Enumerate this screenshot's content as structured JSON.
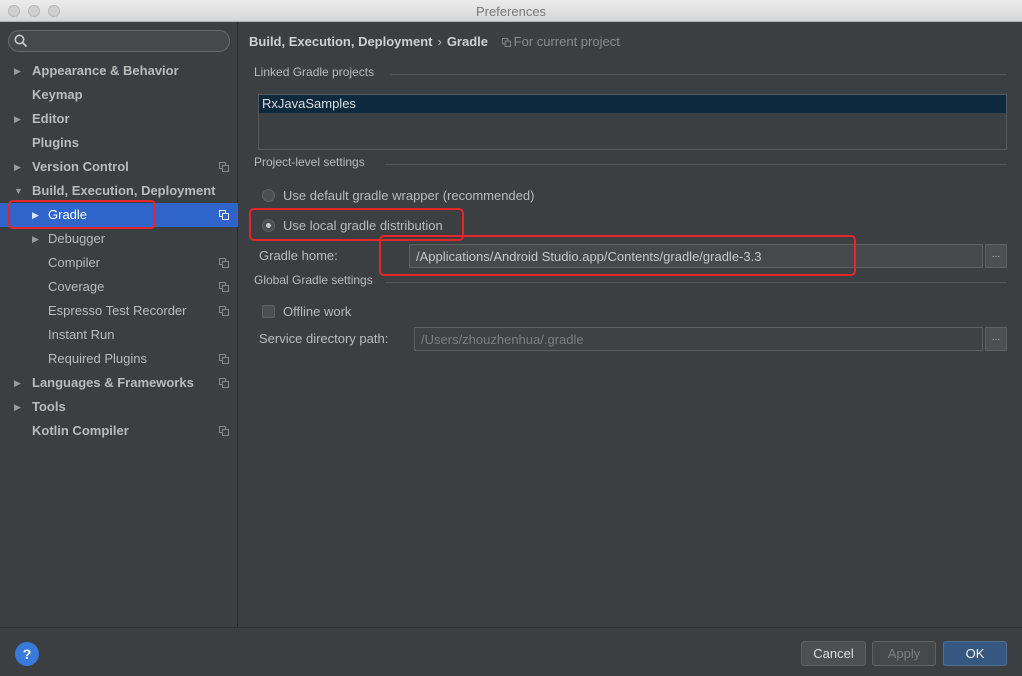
{
  "window": {
    "title": "Preferences"
  },
  "search": {
    "value": "",
    "placeholder": ""
  },
  "sidebar": {
    "items": [
      {
        "label": "Appearance & Behavior",
        "arrow": "▶"
      },
      {
        "label": "Keymap",
        "arrow": ""
      },
      {
        "label": "Editor",
        "arrow": "▶"
      },
      {
        "label": "Plugins",
        "arrow": ""
      },
      {
        "label": "Version Control",
        "arrow": "▶"
      },
      {
        "label": "Build, Execution, Deployment",
        "arrow": "▼"
      },
      {
        "label": "Gradle",
        "arrow": "▶"
      },
      {
        "label": "Debugger",
        "arrow": "▶"
      },
      {
        "label": "Compiler",
        "arrow": ""
      },
      {
        "label": "Coverage",
        "arrow": ""
      },
      {
        "label": "Espresso Test Recorder",
        "arrow": ""
      },
      {
        "label": "Instant Run",
        "arrow": ""
      },
      {
        "label": "Required Plugins",
        "arrow": ""
      },
      {
        "label": "Languages & Frameworks",
        "arrow": "▶"
      },
      {
        "label": "Tools",
        "arrow": "▶"
      },
      {
        "label": "Kotlin Compiler",
        "arrow": ""
      }
    ],
    "selected": "Gradle"
  },
  "breadcrumb": {
    "parent": "Build, Execution, Deployment",
    "separator": "›",
    "current": "Gradle",
    "scope": "For current project"
  },
  "linked_projects": {
    "title": "Linked Gradle projects",
    "items": [
      "RxJavaSamples"
    ]
  },
  "project_settings": {
    "title": "Project-level settings",
    "option_default": "Use default gradle wrapper (recommended)",
    "option_local": "Use local gradle distribution",
    "selected_option": "local",
    "gradle_home_label": "Gradle home:",
    "gradle_home_value": "/Applications/Android Studio.app/Contents/gradle/gradle-3.3",
    "browse_label": "..."
  },
  "global_settings": {
    "title": "Global Gradle settings",
    "offline_label": "Offline work",
    "offline_checked": false,
    "service_dir_label": "Service directory path:",
    "service_dir_value": "/Users/zhouzhenhua/.gradle",
    "browse_label": "..."
  },
  "footer": {
    "help_label": "?",
    "cancel_label": "Cancel",
    "apply_label": "Apply",
    "ok_label": "OK"
  },
  "colors": {
    "background": "#3c3f41",
    "selection": "#2f65ca",
    "highlight_outline": "#e3262a",
    "primary_button": "#365880",
    "help_button": "#3879d9"
  }
}
